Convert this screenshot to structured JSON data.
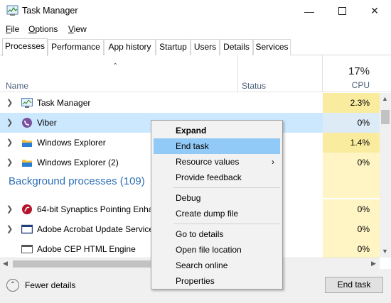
{
  "window": {
    "title": "Task Manager"
  },
  "menu": [
    {
      "pre": "",
      "acc": "F",
      "post": "ile"
    },
    {
      "pre": "",
      "acc": "O",
      "post": "ptions"
    },
    {
      "pre": "",
      "acc": "V",
      "post": "iew"
    }
  ],
  "tabs": [
    "Processes",
    "Performance",
    "App history",
    "Startup",
    "Users",
    "Details",
    "Services"
  ],
  "active_tab": "Processes",
  "columns": {
    "name": "Name",
    "status": "Status",
    "cpu_percent": "17%",
    "cpu": "CPU"
  },
  "apps": [
    {
      "name": "Task Manager",
      "cpu": "2.3%",
      "icon": "task-manager-icon"
    },
    {
      "name": "Viber",
      "cpu": "0%",
      "icon": "viber-icon"
    },
    {
      "name": "Windows Explorer",
      "cpu": "1.4%",
      "icon": "folder-icon"
    },
    {
      "name": "Windows Explorer (2)",
      "cpu": "0%",
      "icon": "folder-icon"
    }
  ],
  "background_group": "Background processes (109)",
  "background": [
    {
      "name": "64-bit Synaptics Pointing Enha",
      "cpu": "0%",
      "icon": "synaptics-icon"
    },
    {
      "name": "Adobe Acrobat Update Service",
      "cpu": "0%",
      "icon": "app-window-icon"
    },
    {
      "name": "Adobe CEP HTML Engine",
      "cpu": "0%",
      "icon": "app-window-icon"
    }
  ],
  "context_menu": [
    {
      "label": "Expand",
      "bold": true
    },
    {
      "label": "End task",
      "hover": true
    },
    {
      "label": "Resource values",
      "submenu": true
    },
    {
      "label": "Provide feedback"
    },
    {
      "label": "Debug"
    },
    {
      "label": "Create dump file"
    },
    {
      "label": "Go to details"
    },
    {
      "label": "Open file location"
    },
    {
      "label": "Search online"
    },
    {
      "label": "Properties"
    }
  ],
  "footer": {
    "fewer_details": "Fewer details",
    "end_task": "End task"
  },
  "colors": {
    "selected_row": "#cce8ff",
    "cpu_cell": "#fff4c4",
    "menu_hover": "#91c9f7",
    "group_heading": "#2d6fb5"
  }
}
